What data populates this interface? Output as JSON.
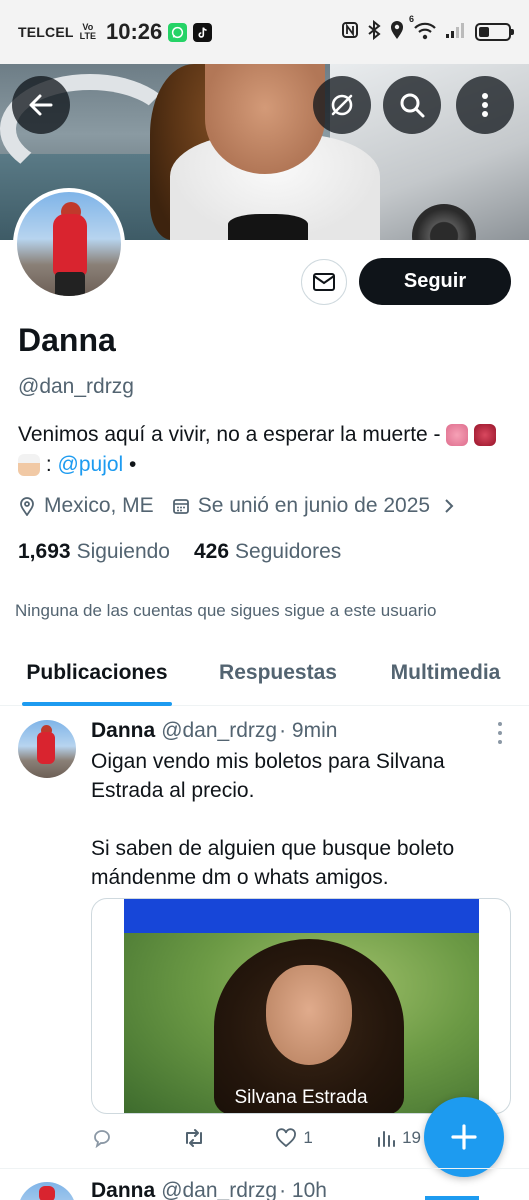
{
  "status_bar": {
    "carrier": "TELCEL",
    "volte_top": "Vo",
    "volte_bottom": "LTE",
    "time": "10:26",
    "apps": [
      "whatsapp-icon",
      "tiktok-icon"
    ],
    "right_icons": [
      "nfc-icon",
      "bluetooth-icon",
      "location-icon",
      "wifi-icon",
      "signal-icon",
      "battery-icon"
    ],
    "wifi_label": "6",
    "battery_level": 0.35
  },
  "header": {
    "buttons": [
      "back-arrow-icon",
      "grok-icon",
      "search-icon",
      "more-vertical-icon"
    ]
  },
  "profile": {
    "name": "Danna",
    "handle": "@dan_rdrzg",
    "message_icon": "envelope-icon",
    "follow_label": "Seguir",
    "bio_text": "Venimos aquí a vivir, no a esperar la muerte - ",
    "bio_separator": " : ",
    "bio_mention": "@pujol",
    "bio_tail": " •",
    "bio_emojis": [
      "brain-emoji",
      "anatomical-heart-emoji",
      "chef-emoji"
    ],
    "location": "Mexico, ME",
    "joined": "Se unió en junio de 2025",
    "following_count": "1,693",
    "following_label": "Siguiendo",
    "followers_count": "426",
    "followers_label": "Seguidores",
    "mutuals_note": "Ninguna de las cuentas que sigues sigue a este usuario"
  },
  "tabs": [
    {
      "label": "Publicaciones",
      "active": true
    },
    {
      "label": "Respuestas",
      "active": false
    },
    {
      "label": "Multimedia",
      "active": false
    }
  ],
  "tweets": [
    {
      "name": "Danna",
      "handle": "@dan_rdrzg",
      "time": "· 9min",
      "text_1": "Oigan vendo mis boletos para Silvana Estrada al precio.",
      "text_2": "Si saben de alguien que busque boleto mándenme dm o whats amigos.",
      "media_caption": "Silvana Estrada",
      "replies": "",
      "retweets": "",
      "likes": "1",
      "views": "19"
    },
    {
      "name": "Danna",
      "handle": "@dan_rdrzg",
      "time": "· 10h"
    }
  ],
  "fab": {
    "icon": "plus-icon"
  },
  "colors": {
    "accent": "#1d9bf0",
    "text_primary": "#0f1419",
    "text_secondary": "#536471",
    "follow_button_bg": "#0f1419"
  }
}
